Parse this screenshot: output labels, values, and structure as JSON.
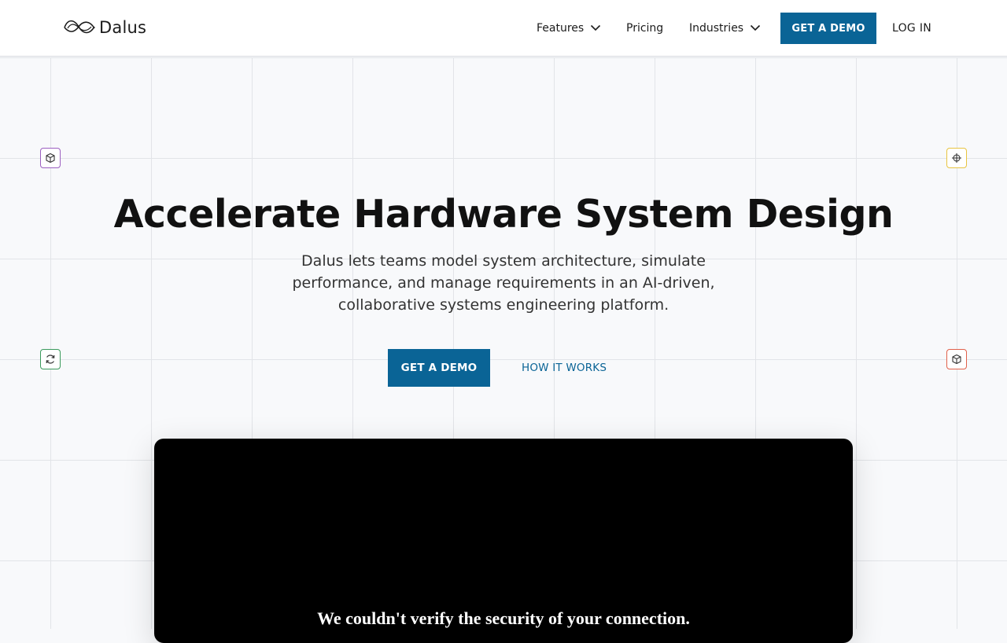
{
  "header": {
    "logo_text": "Dalus",
    "nav": {
      "features": "Features",
      "pricing": "Pricing",
      "industries": "Industries"
    },
    "cta_label": "GET A DEMO",
    "login_label": "LOG IN"
  },
  "hero": {
    "title": "Accelerate Hardware System Design",
    "subtitle": "Dalus lets teams model system architecture, simulate performance, and manage requirements in an AI-driven, collaborative systems engineering platform.",
    "primary_cta": "GET A DEMO",
    "secondary_cta": "HOW IT WORKS"
  },
  "video": {
    "message": "We couldn't verify the security of your connection."
  },
  "corner_icons": [
    {
      "name": "cube-icon",
      "color": "#9b5fc0"
    },
    {
      "name": "crosshair-icon",
      "color": "#e8c440"
    },
    {
      "name": "refresh-icon",
      "color": "#3a9a5c"
    },
    {
      "name": "cube-icon",
      "color": "#e0604a"
    }
  ],
  "colors": {
    "brand": "#0a6496",
    "background": "#f8f9fb",
    "grid_line": "#e2e4e8"
  }
}
